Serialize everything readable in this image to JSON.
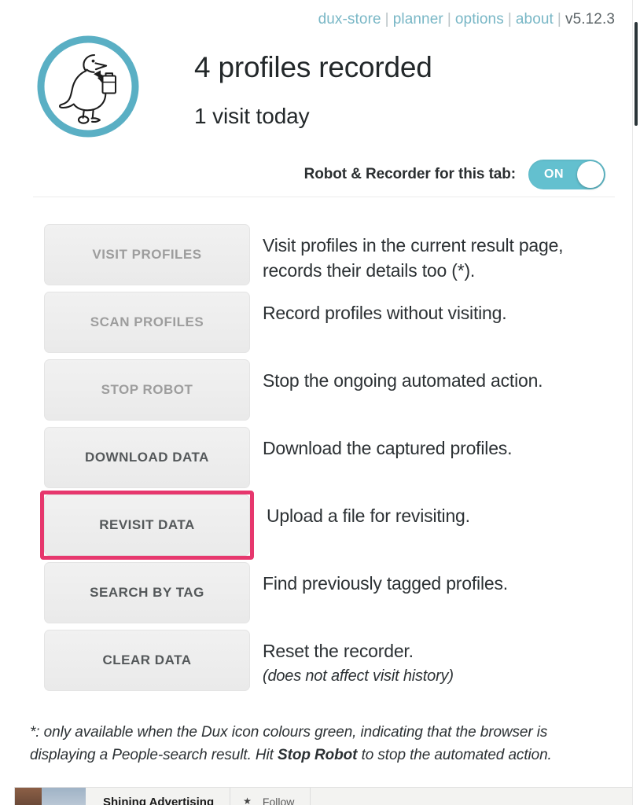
{
  "nav": {
    "links": [
      {
        "label": "dux-store"
      },
      {
        "label": "planner"
      },
      {
        "label": "options"
      },
      {
        "label": "about"
      }
    ],
    "separator": "|",
    "version": "v5.12.3"
  },
  "logo": {
    "icon": "duck-logo-icon",
    "ring_color": "#5aafc4"
  },
  "header": {
    "title": "4 profiles recorded",
    "subtitle": "1 visit today"
  },
  "toggle": {
    "label": "Robot & Recorder for this tab:",
    "state_label": "ON",
    "on_color": "#63c0cf"
  },
  "actions": [
    {
      "button": "VISIT PROFILES",
      "description": "Visit profiles in the current result page, records their details too (*).",
      "disabled": true,
      "highlighted": false
    },
    {
      "button": "SCAN PROFILES",
      "description": "Record profiles without visiting.",
      "disabled": true,
      "highlighted": false
    },
    {
      "button": "STOP ROBOT",
      "description": "Stop the ongoing automated action.",
      "disabled": true,
      "highlighted": false
    },
    {
      "button": "DOWNLOAD DATA",
      "description": "Download the captured profiles.",
      "disabled": false,
      "highlighted": false
    },
    {
      "button": "REVISIT DATA",
      "description": "Upload a file for revisiting.",
      "disabled": false,
      "highlighted": true
    },
    {
      "button": "SEARCH BY TAG",
      "description": "Find previously tagged profiles.",
      "disabled": false,
      "highlighted": false
    },
    {
      "button": "CLEAR DATA",
      "description": "Reset the recorder.",
      "note": "(does not affect visit history)",
      "disabled": false,
      "highlighted": false
    }
  ],
  "footnote": {
    "part1": "*: only available when the Dux icon colours green, indicating that the browser is displaying a People-search result. Hit ",
    "emphasis": "Stop Robot",
    "part2": " to stop the automated action."
  },
  "page_behind": {
    "name": "Shining Advertising",
    "follow": "Follow",
    "star": "★"
  },
  "highlight_color": "#e6376d"
}
